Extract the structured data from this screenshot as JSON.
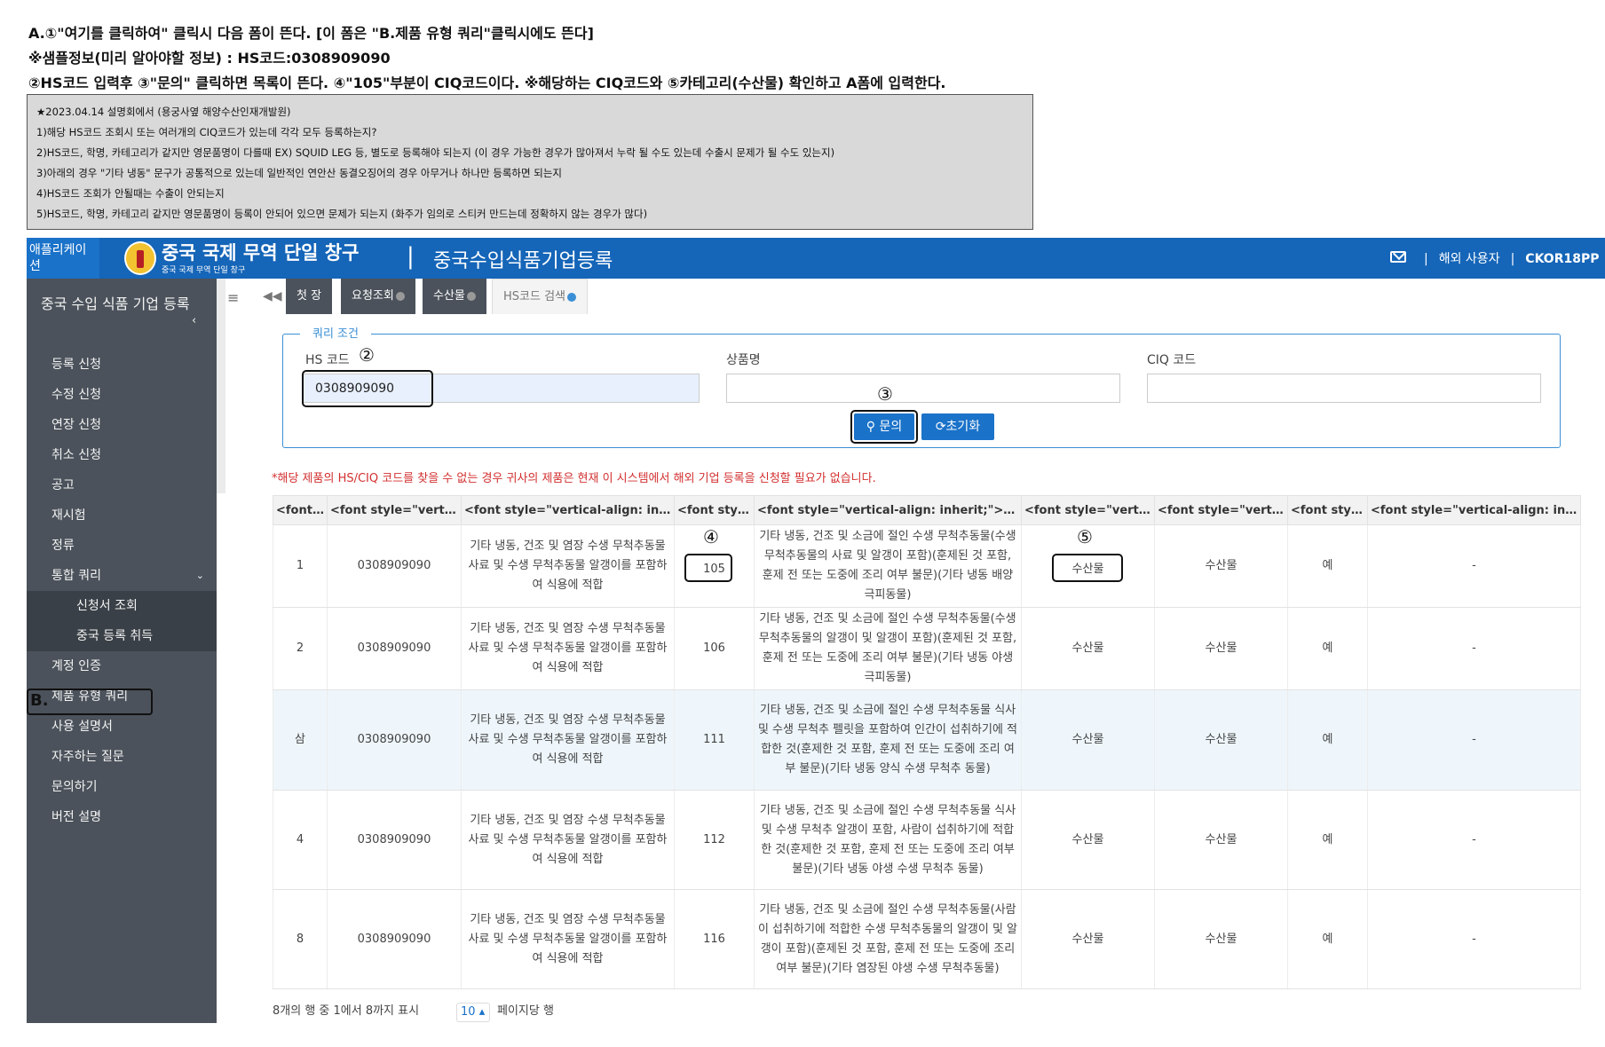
{
  "instructions": {
    "line1": "A.①\"여기를 클릭하여\" 클릭시 다음 폼이 뜬다. [이 폼은 \"B.제품 유형 쿼리\"클릭시에도 뜬다]",
    "line2": "※샘플정보(미리 알아야할 정보) : HS코드:0308909090",
    "line3": "②HS코드 입력후 ③\"문의\" 클릭하면 목록이 뜬다. ④\"105\"부분이 CIQ코드이다. ※해당하는 CIQ코드와 ⑤카테고리(수산물) 확인하고 A폼에 입력한다."
  },
  "notes": [
    "★2023.04.14 설명회에서 (용궁사옆 해양수산인재개발원)",
    "1)해당 HS코드 조회시 또는 여러개의 CIQ코드가 있는데 각각 모두 등록하는지?",
    "2)HS코드, 학명, 카테고리가 같지만 영문품명이 다를때 EX) SQUID LEG 등, 별도로 등록해야 되는지 (이 경우 가능한 경우가 많아져서 누락 될 수도 있는데 수출시 문제가 될 수도 있는지)",
    "3)아래의 경우 \"기타 냉동\" 문구가 공통적으로 있는데 일반적인 연안산 동결오징어의 경우 아무거나 하나만 등록하면 되는지",
    "4)HS코드 조회가 안될때는 수출이 안되는지",
    "5)HS코드, 학명, 카테고리 같지만 영문품명이 등록이 안되어 있으면 문제가 되는지 (화주가 임의로 스티커 만드는데 정확하지 않는 경우가 많다)"
  ],
  "header": {
    "app_button": "애플리케이션",
    "logo_title": "중국 국제 무역 단일 창구",
    "logo_sub": "중국 국제 무역 단일 창구",
    "separator": "|",
    "title": "중국수입식품기업등록",
    "user": "해외 사용자",
    "account": "CKOR18PP"
  },
  "sidebar": {
    "heading": "중국 수입 식품 기업 등록",
    "items": [
      "등록 신청",
      "수정 신청",
      "연장 신청",
      "취소 신청",
      "공고",
      "재시험",
      "정류",
      "통합 쿼리",
      "신청서 조회",
      "중국 등록 취득",
      "계정 인증",
      "제품 유형 쿼리",
      "사용 설명서",
      "자주하는 질문",
      "문의하기",
      "버전 설명"
    ],
    "b_marker": "B."
  },
  "tabs": [
    "첫 장",
    "요청조회",
    "수산물",
    "HS코드 검색"
  ],
  "query": {
    "legend": "쿼리 조건",
    "hs_label": "HS 코드",
    "hs_value": "0308909090",
    "name_label": "상품명",
    "ciq_label": "CIQ 코드",
    "search_btn": "문의",
    "reset_btn": "초기화"
  },
  "markers": {
    "m2": "②",
    "m3": "③",
    "m4": "④",
    "m5": "⑤"
  },
  "warning": "*해당 제품의 HS/CIQ 코드를 찾을 수 없는 경우 귀사의 제품은 현재 이 시스템에서 해외 기업 등록을 신청할 필요가 없습니다.",
  "table": {
    "headers": [
      "<font style=\"vertical-align: inherit;\">",
      "<font style=\"vertical-align: inherit;\">",
      "<font style=\"vertical-align: inherit;\">",
      "<font style=\"vertical-align: inherit;\">",
      "<font style=\"vertical-align: inherit;\"><font style=\"vertical-align: inherit;\">",
      "<font style=\"vertical-align: inherit;\">",
      "<font style=\"vertical-align: inherit;\">",
      "<font style=\"vertical-align: inherit;\">",
      "<font style=\"vertical-align: inherit;\">"
    ],
    "rows": [
      {
        "no": "1",
        "hs": "0308909090",
        "name": "기타 냉동, 건조 및 염장 수생 무척추동물 사료 및 수생 무척추동물 알갱이를 포함하여 식용에 적합",
        "ciq": "105",
        "desc": "기타 냉동, 건조 및 소금에 절인 수생 무척추동물(수생 무척추동물의 사료 및 알갱이 포함)(훈제된 것 포함, 훈제 전 또는 도중에 조리 여부 불문)(기타 냉동 배양 극피동물)",
        "cat1": "수산물",
        "cat2": "수산물",
        "yn": "예",
        "etc": "-"
      },
      {
        "no": "2",
        "hs": "0308909090",
        "name": "기타 냉동, 건조 및 염장 수생 무척추동물 사료 및 수생 무척추동물 알갱이를 포함하여 식용에 적합",
        "ciq": "106",
        "desc": "기타 냉동, 건조 및 소금에 절인 수생 무척추동물(수생 무척추동물의 알갱이 및 알갱이 포함)(훈제된 것 포함, 훈제 전 또는 도중에 조리 여부 불문)(기타 냉동 야생 극피동물)",
        "cat1": "수산물",
        "cat2": "수산물",
        "yn": "예",
        "etc": "-"
      },
      {
        "no": "삼",
        "hs": "0308909090",
        "name": "기타 냉동, 건조 및 염장 수생 무척추동물 사료 및 수생 무척추동물 알갱이를 포함하여 식용에 적합",
        "ciq": "111",
        "desc": "기타 냉동, 건조 및 소금에 절인 수생 무척추동물 식사 및 수생 무척추 펠릿을 포함하여 인간이 섭취하기에 적합한 것(훈제한 것 포함, 훈제 전 또는 도중에 조리 여부 불문)(기타 냉동 양식 수생 무척추 동물)",
        "cat1": "수산물",
        "cat2": "수산물",
        "yn": "예",
        "etc": "-"
      },
      {
        "no": "4",
        "hs": "0308909090",
        "name": "기타 냉동, 건조 및 염장 수생 무척추동물 사료 및 수생 무척추동물 알갱이를 포함하여 식용에 적합",
        "ciq": "112",
        "desc": "기타 냉동, 건조 및 소금에 절인 수생 무척추동물 식사 및 수생 무척추 알갱이 포함, 사람이 섭취하기에 적합한 것(훈제한 것 포함, 훈제 전 또는 도중에 조리 여부 불문)(기타 냉동 야생 수생 무척추 동물)",
        "cat1": "수산물",
        "cat2": "수산물",
        "yn": "예",
        "etc": "-"
      },
      {
        "no": "8",
        "hs": "0308909090",
        "name": "기타 냉동, 건조 및 염장 수생 무척추동물 사료 및 수생 무척추동물 알갱이를 포함하여 식용에 적합",
        "ciq": "116",
        "desc": "기타 냉동, 건조 및 소금에 절인 수생 무척추동물(사람이 섭취하기에 적합한 수생 무척추동물의 알갱이 및 알갱이 포함)(훈제된 것 포함, 훈제 전 또는 도중에 조리 여부 불문)(기타 염장된 야생 수생 무척추동물)",
        "cat1": "수산물",
        "cat2": "수산물",
        "yn": "예",
        "etc": "-"
      }
    ]
  },
  "footer": {
    "summary": "8개의 행 중 1에서 8까지 표시",
    "page_size": "10",
    "per_page": "페이지당 행"
  }
}
